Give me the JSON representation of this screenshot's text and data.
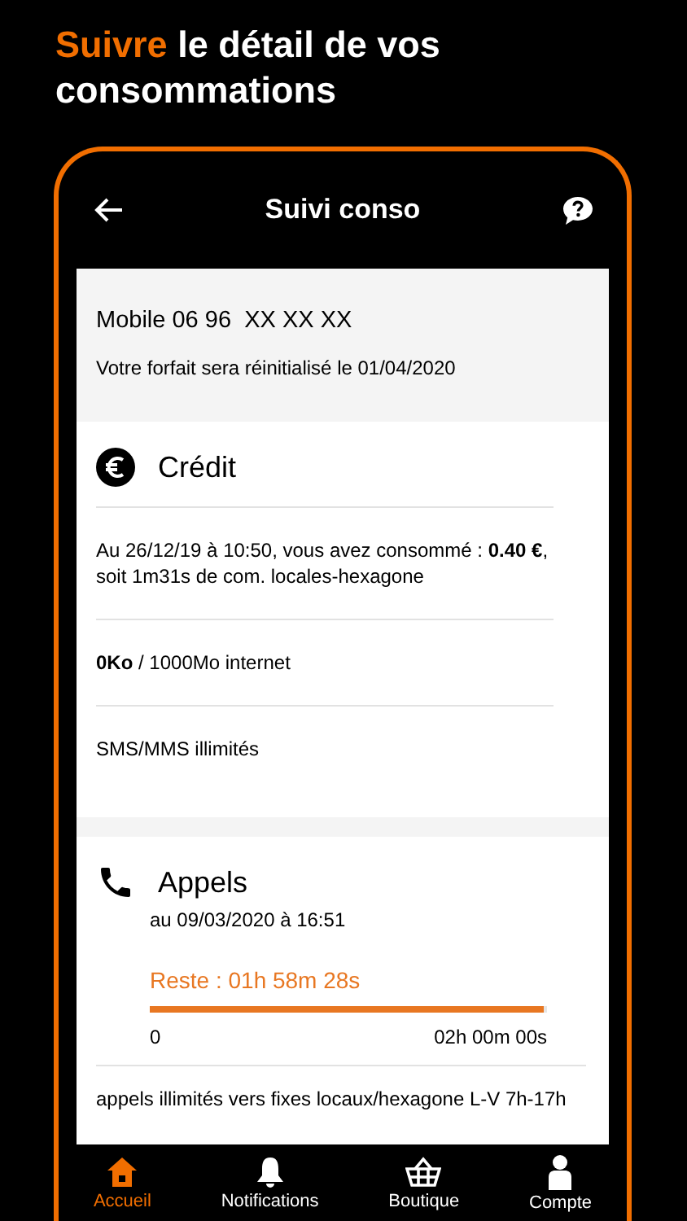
{
  "headline": {
    "highlight": "Suivre",
    "rest": "le détail de vos consommations"
  },
  "header": {
    "title": "Suivi conso"
  },
  "account": {
    "line": "Mobile 06 96  XX XX XX",
    "reset": "Votre forfait sera réinitialisé le 01/04/2020"
  },
  "sections": [
    {
      "kind": "credit",
      "title": "Crédit",
      "lines": [
        "Au 26/12/19 à 10:50, vous avez consommé : **0.40 €**, soit 1m31s de com. locales-hexagone",
        "**0Ko** / 1000Mo internet",
        "SMS/MMS illimités"
      ]
    },
    {
      "kind": "calls",
      "title": "Appels",
      "date": "au 09/03/2020 à 16:51",
      "remaining": "Reste : 01h 58m 28s",
      "level": 0.99,
      "min": "0",
      "max": "02h 00m 00s",
      "lines": [
        "appels illimités vers fixes locaux/hexagone L-V 7h-17h"
      ]
    }
  ],
  "nav": [
    {
      "label": "Accueil",
      "kind": "home",
      "selected": true
    },
    {
      "label": "Notifications",
      "kind": "bell",
      "selected": false
    },
    {
      "label": "Boutique",
      "kind": "basket",
      "selected": false
    },
    {
      "label": "Compte",
      "kind": "person",
      "selected": false
    }
  ]
}
